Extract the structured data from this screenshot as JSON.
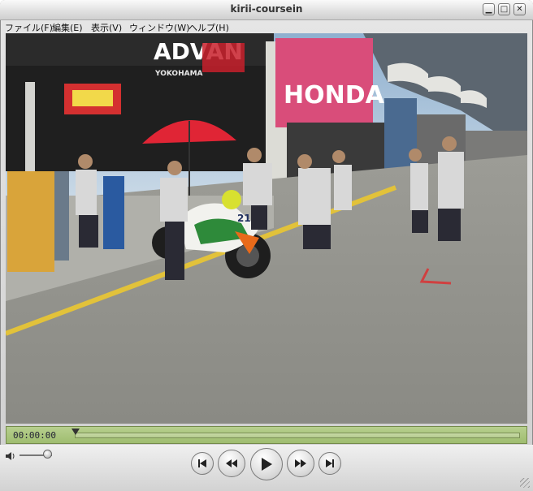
{
  "window": {
    "title": "kirii-coursein",
    "buttons": {
      "minimize": "▁",
      "maximize": "□",
      "close": "✕"
    }
  },
  "menus": [
    "ファイル(F)",
    "編集(E)",
    "表示(V)",
    "ウィンドウ(W)",
    "ヘルプ(H)"
  ],
  "scene": {
    "sign_advan": "ADVAN",
    "sign_yokohama": "YOKOHAMA",
    "sign_honda": "HONDA",
    "bike_number": "21"
  },
  "timeline": {
    "timecode": "00:00:00",
    "progress": 0
  },
  "volume": {
    "level": 0.85
  },
  "icons": {
    "volume": "speaker-icon",
    "to_start": "skip-back-icon",
    "rewind": "rewind-icon",
    "play": "play-icon",
    "forward": "fast-forward-icon",
    "to_end": "skip-forward-icon"
  }
}
